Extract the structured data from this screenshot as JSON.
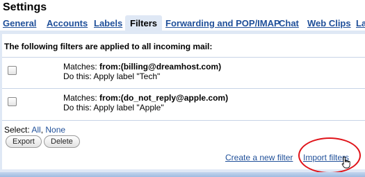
{
  "page_title": "Settings",
  "tabs": [
    {
      "label": "General"
    },
    {
      "label": "Accounts"
    },
    {
      "label": "Labels"
    },
    {
      "label": "Filters",
      "active": true
    },
    {
      "label": "Forwarding and POP/IMAP"
    },
    {
      "label": "Chat"
    },
    {
      "label": "Web Clips"
    },
    {
      "label": "La"
    }
  ],
  "filters_header": "The following filters are applied to all incoming mail:",
  "filters": [
    {
      "matches_prefix": "Matches: ",
      "matches_value": "from:(billing@dreamhost.com)",
      "action": "Do this: Apply label \"Tech\"",
      "checked": false
    },
    {
      "matches_prefix": "Matches: ",
      "matches_value": "from:(do_not_reply@apple.com)",
      "action": "Do this: Apply label \"Apple\"",
      "checked": false
    }
  ],
  "select": {
    "prefix": "Select: ",
    "all": "All",
    "separator": ", ",
    "none": "None"
  },
  "buttons": {
    "export": "Export",
    "delete": "Delete"
  },
  "links": {
    "create_filter": "Create a new filter",
    "import_filters": "Import filters"
  },
  "colors": {
    "link_blue": "#1f4f99",
    "panel_bg": "#dfe8f5",
    "highlight_circle": "#e0141a"
  }
}
